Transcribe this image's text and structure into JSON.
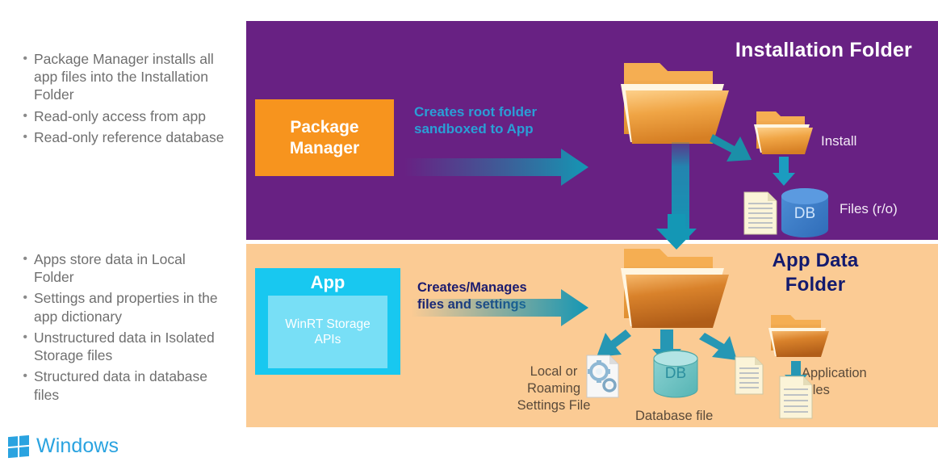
{
  "bullets_top": [
    {
      "marker": "•",
      "text": "Package Manager installs all app files into the Installation Folder"
    },
    {
      "marker": "•",
      "text": "Read-only access from app"
    },
    {
      "marker": "•",
      "text": "Read-only reference database"
    }
  ],
  "bullets_bottom": [
    {
      "marker": "•",
      "text": "Apps store data in Local Folder"
    },
    {
      "marker": "•",
      "text": "Settings and properties in the app dictionary"
    },
    {
      "marker": "•",
      "text": "Unstructured data in Isolated Storage files"
    },
    {
      "marker": "•",
      "text": "Structured data in database files"
    }
  ],
  "install_panel": {
    "title": "Installation Folder",
    "package_manager_label": "Package\nManager",
    "creates_root_label": "Creates root folder\nsandboxed to App",
    "install_label": "Install",
    "files_ro_label": "Files (r/o)",
    "db_label": "DB",
    "background_color": "#682183",
    "box_color": "#f7941e",
    "accent_text_color": "#2a9fd6",
    "db_color": "#3d7cc9"
  },
  "appdata_panel": {
    "title": "App Data\nFolder",
    "app_label": "App",
    "winrt_label": "WinRT Storage\nAPIs",
    "creates_manages_label": "Creates/Manages\nfiles and settings",
    "local_roaming_label": "Local or\nRoaming\nSettings File",
    "database_file_label": "Database file",
    "application_files_label": "Application\nFiles",
    "db_label": "DB",
    "background_color": "#fbcb94",
    "app_box_color": "#18c8f0",
    "title_color": "#121a6e",
    "db_color": "#5fc0c0"
  },
  "arrow_color": "#1a8fa8",
  "footer": {
    "brand": "Windows",
    "brand_color": "#2aa3e0"
  },
  "icons": {
    "folder_open": "folder-open-icon",
    "document": "document-icon",
    "database": "database-cylinder-icon",
    "settings_file": "settings-file-icon",
    "windows_logo": "windows-logo-icon"
  }
}
